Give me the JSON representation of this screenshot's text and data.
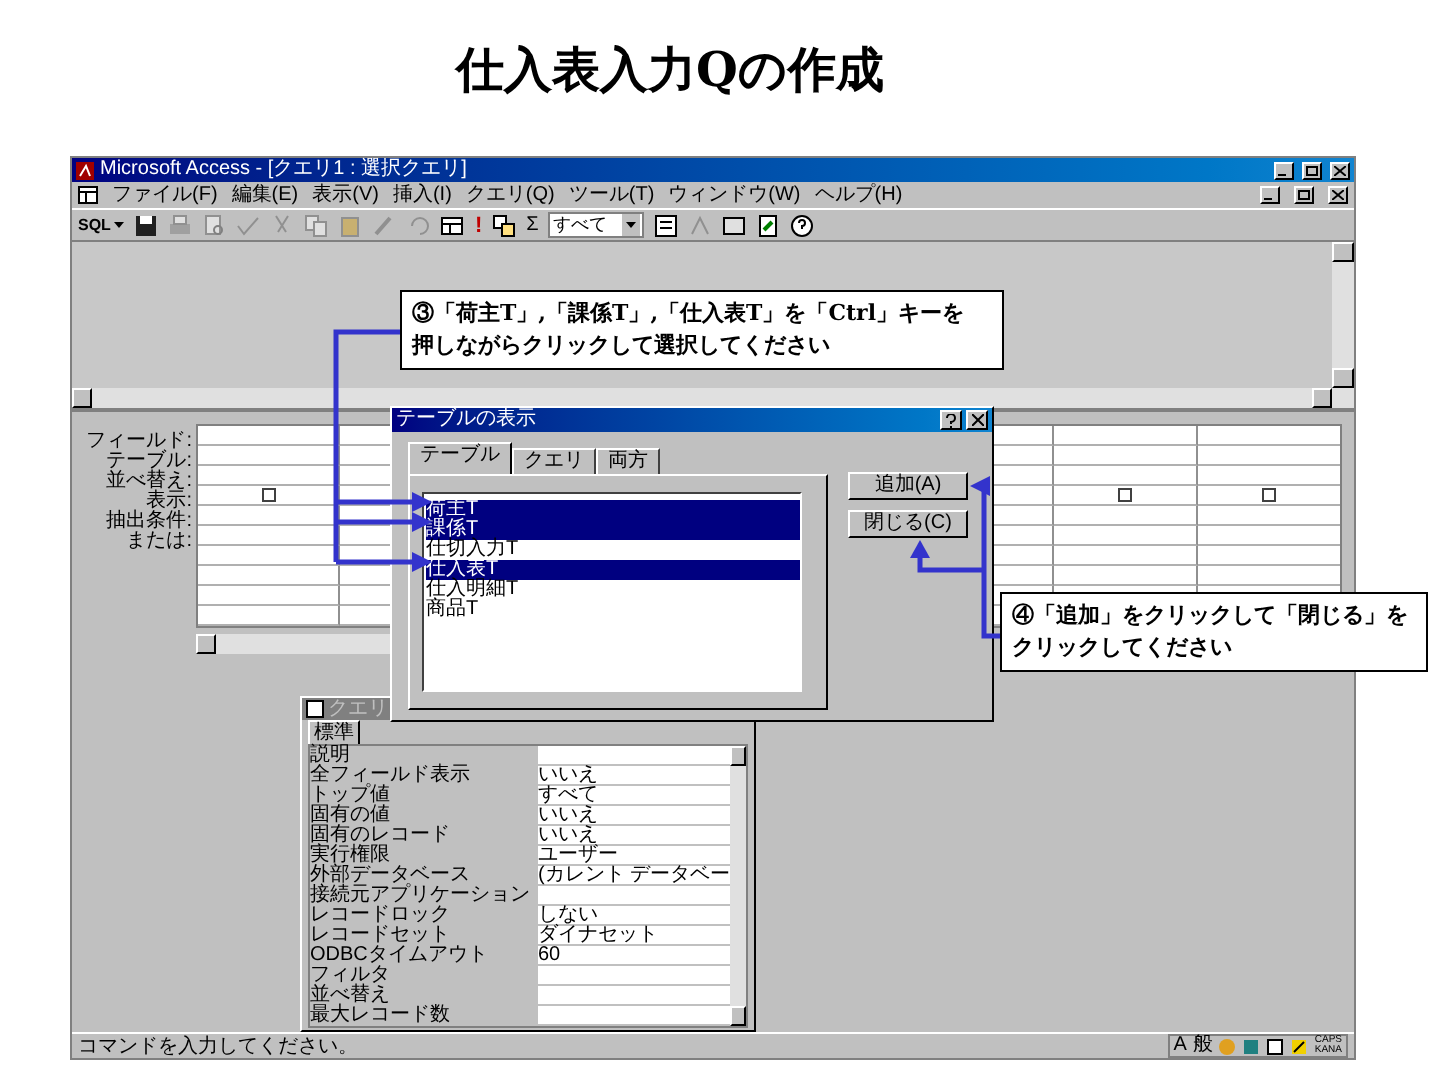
{
  "slide_title": "仕入表入力Qの作成",
  "window": {
    "title": "Microsoft Access - [クエリ1 : 選択クエリ]"
  },
  "menu": [
    "ファイル(F)",
    "編集(E)",
    "表示(V)",
    "挿入(I)",
    "クエリ(Q)",
    "ツール(T)",
    "ウィンドウ(W)",
    "ヘルプ(H)"
  ],
  "toolbar": {
    "view_button": "SQL",
    "run_button": "!",
    "sum_button": "Σ",
    "top_values": "すべて"
  },
  "grid": {
    "row_labels": [
      "フィールド:",
      "テーブル:",
      "並べ替え:",
      "表示:",
      "抽出条件:",
      "または:"
    ],
    "show_checkboxes": [
      {
        "checked": false
      },
      {
        "checked": false
      },
      {
        "checked": false
      }
    ]
  },
  "dialog": {
    "title": "テーブルの表示",
    "tabs": [
      {
        "label": "テーブル",
        "selected": true
      },
      {
        "label": "クエリ",
        "selected": false
      },
      {
        "label": "両方",
        "selected": false
      }
    ],
    "items": [
      {
        "label": "荷主T",
        "selected": true
      },
      {
        "label": "課係T",
        "selected": true
      },
      {
        "label": "仕切入力T",
        "selected": false
      },
      {
        "label": "仕入表T",
        "selected": true
      },
      {
        "label": "仕入明細T",
        "selected": false
      },
      {
        "label": "商品T",
        "selected": false
      }
    ],
    "buttons": [
      "追加(A)",
      "閉じる(C)"
    ]
  },
  "properties": {
    "title": "クエリ",
    "tab": "標準",
    "rows": [
      {
        "name": "説明"
      },
      {
        "name": "全フィールド表示",
        "value": "いいえ"
      },
      {
        "name": "トップ値",
        "value": "すべて"
      },
      {
        "name": "固有の値",
        "value": "いいえ"
      },
      {
        "name": "固有のレコード",
        "value": "いいえ"
      },
      {
        "name": "実行権限",
        "value": "ユーザー"
      },
      {
        "name": "外部データベース",
        "value": "(カレント データベー"
      },
      {
        "name": "接続元アプリケーション"
      },
      {
        "name": "レコードロック",
        "value": "しない"
      },
      {
        "name": "レコードセット",
        "value": "ダイナセット"
      },
      {
        "name": "ODBCタイムアウト",
        "value": "60"
      },
      {
        "name": "フィルタ"
      },
      {
        "name": "並べ替え"
      },
      {
        "name": "最大レコード数"
      }
    ]
  },
  "status_bar": {
    "message": "コマンドを入力してください。",
    "ime": [
      "A",
      "般"
    ],
    "keys": [
      "CAPS",
      "KANA"
    ]
  },
  "callouts": [
    {
      "lines": [
        "③「荷主T」,「課係T」,「仕入表T」を「Ctrl」キーを",
        "押しながらクリックして選択してください"
      ]
    },
    {
      "lines": [
        "④「追加」をクリックして「閉じる」を",
        "クリックしてください"
      ]
    }
  ]
}
